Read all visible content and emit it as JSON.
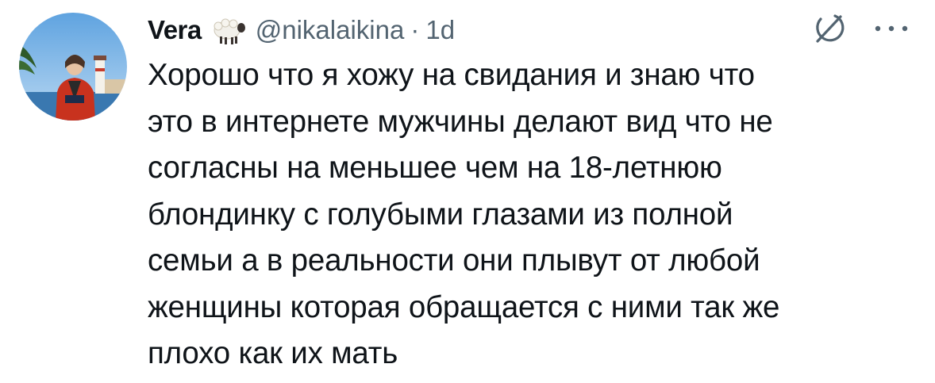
{
  "tweet": {
    "author": {
      "display_name": "Vera",
      "name_emoji": "sheep-icon",
      "handle": "@nikalaikina",
      "separator": "·",
      "time": "1d"
    },
    "text_lines": [
      "Хорошо что я хожу на свидания и знаю что",
      "это в интернете мужчины делают вид что не",
      "согласны на меньшее чем на 18-летнюю",
      "блондинку с голубыми глазами из полной",
      "семьи а в реальности они плывут от любой",
      "женщины которая обращается с ними так же",
      "плохо как их мать"
    ],
    "icons": [
      "avatar",
      "sheep-icon",
      "grok-icon",
      "more-icon"
    ],
    "colors": {
      "text": "#0f1419",
      "secondary": "#536471",
      "background": "#ffffff"
    }
  }
}
